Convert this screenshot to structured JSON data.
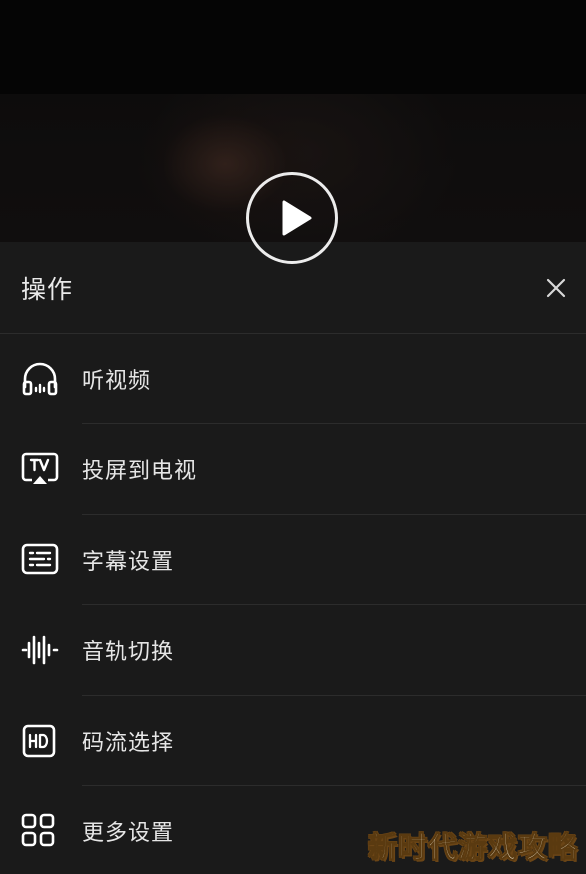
{
  "player": {
    "play_icon": "play-icon",
    "is_playing": false
  },
  "sheet": {
    "title": "操作",
    "close_icon": "close-icon",
    "items": [
      {
        "label": "听视频",
        "icon": "headphones-icon"
      },
      {
        "label": "投屏到电视",
        "icon": "tv-cast-icon"
      },
      {
        "label": "字幕设置",
        "icon": "subtitles-icon"
      },
      {
        "label": "音轨切换",
        "icon": "audio-waveform-icon"
      },
      {
        "label": "码流选择",
        "icon": "hd-icon"
      },
      {
        "label": "更多设置",
        "icon": "grid-icon"
      }
    ]
  },
  "watermark": {
    "text": "新时代游戏攻略"
  },
  "colors": {
    "sheet_background": "#1a1a1a",
    "text": "#e6e6e6",
    "divider": "#2c2c2c",
    "icon": "#ffffff"
  }
}
